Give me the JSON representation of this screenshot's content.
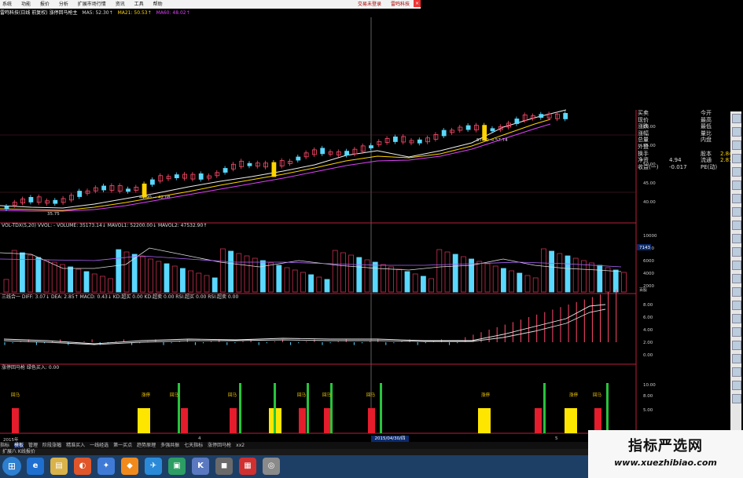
{
  "menu": {
    "items": [
      "系统",
      "功能",
      "报价",
      "分析",
      "扩展市场行情",
      "资讯",
      "工具",
      "帮助"
    ],
    "right_items": [
      "交易未登录",
      "雷鸣科技"
    ],
    "close": "×"
  },
  "title": {
    "stock": "雷鸣科技(日线 前复权) 涨停回马枪主",
    "ma5": "MA5: 52.30↑",
    "ma21": "MA21: 50.53↑",
    "ma60": "MA60: 48.02↑"
  },
  "price_axis": [
    "60.00",
    "55.00",
    "50.00",
    "45.00",
    "40.00"
  ],
  "price_markers": [
    "57.60 → 57.74",
    "41.90 → 42.08",
    "35.75"
  ],
  "info_panel": [
    {
      "k": "买卖",
      "v": "",
      "k2": "今开",
      "v2": ""
    },
    {
      "k": "现价",
      "v": "",
      "k2": "最高",
      "v2": ""
    },
    {
      "k": "涨跌",
      "v": "",
      "k2": "最低",
      "v2": ""
    },
    {
      "k": "涨幅",
      "v": "",
      "k2": "量比",
      "v2": ""
    },
    {
      "k": "总量",
      "v": "",
      "k2": "内盘",
      "v2": ""
    },
    {
      "k": "外盘",
      "v": "",
      "k2": "",
      "v2": ""
    },
    {
      "k": "换手",
      "v": "",
      "k2": "股本",
      "v2": "2.84亿"
    },
    {
      "k": "净资",
      "v": "4.94",
      "k2": "流通",
      "v2": "2.81亿"
    },
    {
      "k": "收益(一)",
      "v": "-0.017",
      "k2": "PE(动)",
      "v2": ""
    }
  ],
  "vol_panel": {
    "header": "VOL-TDX(5,20)  VVOL: -   VOLUME: 35173.14↓  MAVOL1: 52200.00↓  MAVOL2: 47532.90↑",
    "axis": [
      "10000",
      "8000",
      "6000",
      "4000",
      "2000"
    ],
    "badge_top": "7143",
    "badge_bottom": "百股"
  },
  "macd_panel": {
    "header": "三线合一  DIFF: 3.07↓  DEA: 2.85↑  MACD: 0.43↓  KD:超买 0.00  KD:超卖 0.00  RSI:超买 0.00  RSI:超卖 0.00",
    "axis": [
      "8.00",
      "6.00",
      "4.00",
      "2.00",
      "0.00"
    ]
  },
  "signal_panel": {
    "header": "涨停回马枪   绿色买入: 0.00",
    "axis": [
      "10.00",
      "8.00",
      "5.00"
    ],
    "labels": [
      "回马",
      "涨停",
      "回马",
      "回马",
      "回马",
      "回马",
      "回马",
      "涨停",
      "涨停",
      "回马"
    ]
  },
  "date_axis": {
    "left": "2015年",
    "mid_marker": "4",
    "selected": "2015/04/30/四",
    "right_marker": "5"
  },
  "tabs": [
    "指标",
    "模板",
    "管理",
    "阶段涨幅",
    "精准买入",
    "一线经选",
    "第一买点",
    "趋势原理",
    "多强共振",
    "七天指标",
    "涨停回马枪",
    "xx2"
  ],
  "tab_selected_index": 1,
  "status": "扩展八   K线报价",
  "watermark": {
    "line1": "指标严选网",
    "line2": "www.xuezhibiao.com"
  },
  "chart_data": [
    {
      "type": "candlestick",
      "title": "",
      "ylim": [
        35,
        63
      ],
      "ylabel": "",
      "ma_lines": [
        "MA5",
        "MA21",
        "MA60"
      ]
    },
    {
      "type": "bar",
      "title": "VOL-TDX(5,20)",
      "ylim": [
        0,
        11000
      ]
    },
    {
      "type": "line",
      "title": "三线合一",
      "ylim": [
        -1,
        9
      ],
      "series": [
        {
          "name": "DIFF",
          "values": [
            3.07
          ]
        },
        {
          "name": "DEA",
          "values": [
            2.85
          ]
        }
      ]
    },
    {
      "type": "bar",
      "title": "涨停回马枪",
      "ylim": [
        0,
        12
      ]
    }
  ]
}
